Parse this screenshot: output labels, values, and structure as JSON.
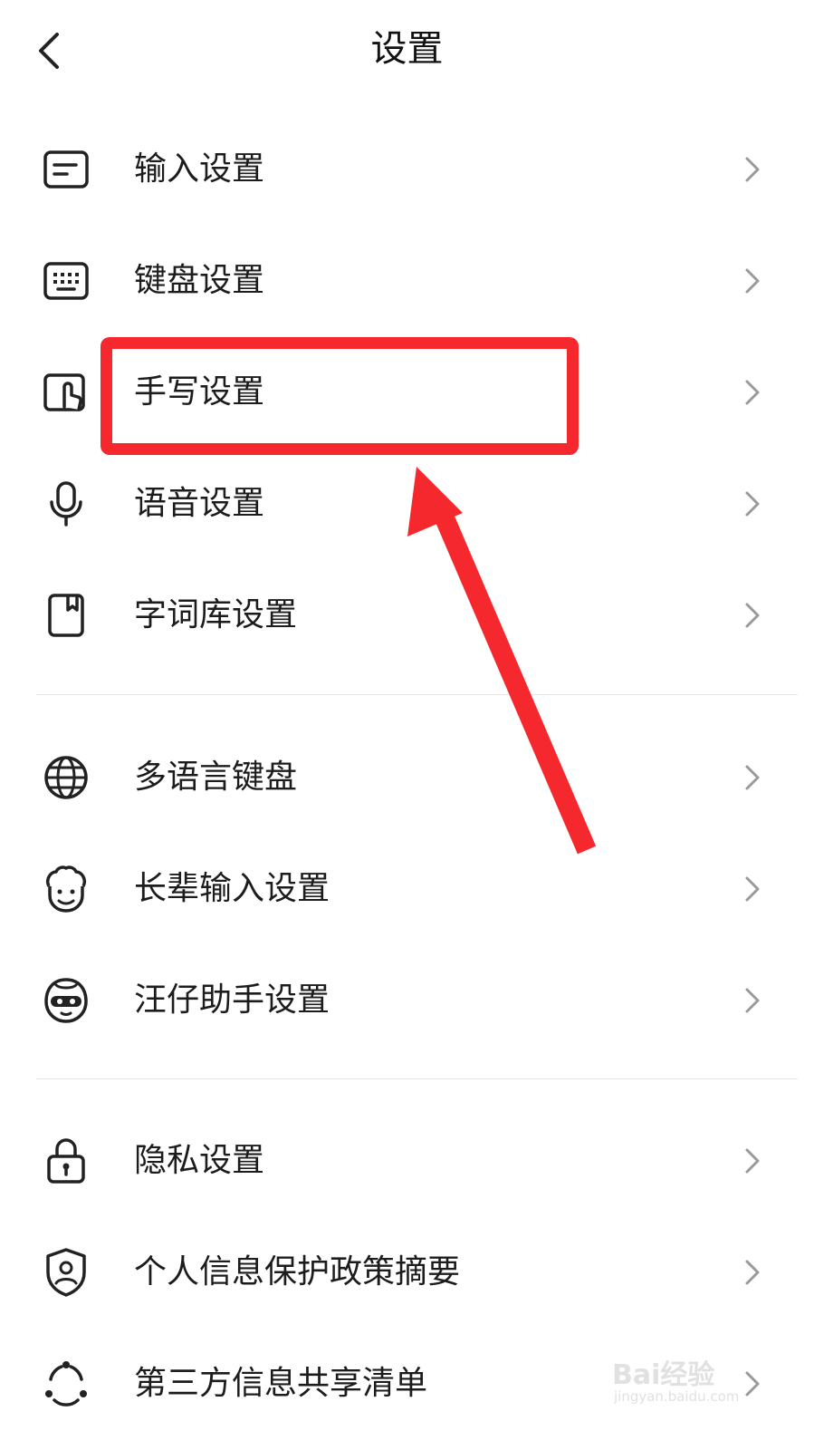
{
  "header": {
    "title": "设置",
    "back_icon": "chevron-left-icon"
  },
  "groups": [
    {
      "items": [
        {
          "label": "输入设置",
          "icon": "input-box-icon"
        },
        {
          "label": "键盘设置",
          "icon": "keyboard-icon"
        },
        {
          "label": "手写设置",
          "icon": "handwriting-icon"
        },
        {
          "label": "语音设置",
          "icon": "microphone-icon"
        },
        {
          "label": "字词库设置",
          "icon": "bookmark-book-icon"
        }
      ]
    },
    {
      "items": [
        {
          "label": "多语言键盘",
          "icon": "globe-icon"
        },
        {
          "label": "长辈输入设置",
          "icon": "elder-face-icon"
        },
        {
          "label": "汪仔助手设置",
          "icon": "mascot-icon"
        }
      ]
    },
    {
      "items": [
        {
          "label": "隐私设置",
          "icon": "lock-icon"
        },
        {
          "label": "个人信息保护政策摘要",
          "icon": "shield-user-icon"
        },
        {
          "label": "第三方信息共享清单",
          "icon": "share-nodes-icon"
        }
      ]
    }
  ],
  "annotation": {
    "highlight_color": "#f5282d",
    "highlighted_item": "手写设置"
  },
  "watermark": {
    "brand": "Bai经验",
    "url": "jingyan.baidu.com"
  }
}
